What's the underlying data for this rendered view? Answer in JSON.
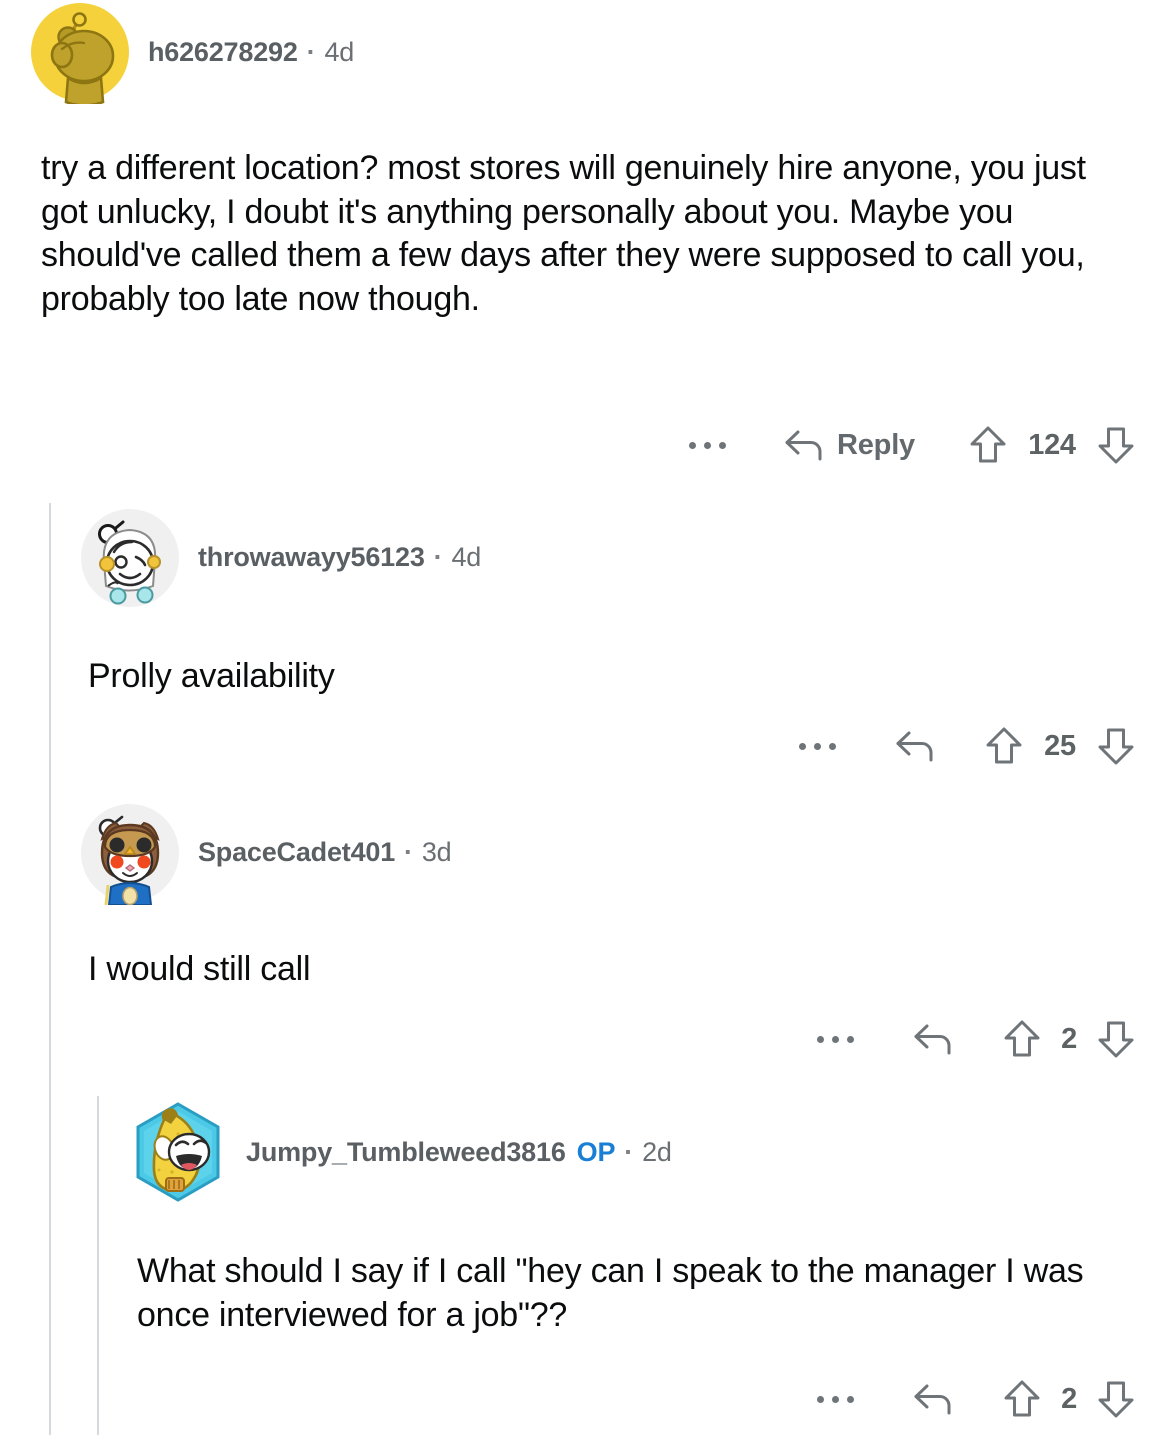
{
  "theme": {
    "background": "#ffffff",
    "text_primary": "#0b0c0d",
    "text_meta": "#5a5f63",
    "icon": "#6f7478",
    "op_blue": "#1a7fd4",
    "thread_line": "#d7dadc"
  },
  "comments": [
    {
      "id": "c1",
      "author": "h626278292",
      "timestamp": "4d",
      "is_op": false,
      "op_label": "",
      "separator": "·",
      "body": "try a different location? most stores will genuinely hire anyone, you just got unlucky, I doubt it's anything personally about you. Maybe you should've called them a few days after they were supposed to call you, probably too late now though.",
      "actions": {
        "more_label": "more-options",
        "reply_label": "Reply",
        "show_reply_label": true,
        "upvote_label": "upvote",
        "downvote_label": "downvote",
        "score": "124"
      },
      "avatar": "snoo-yellow"
    },
    {
      "id": "c2",
      "author": "throwawayy56123",
      "timestamp": "4d",
      "is_op": false,
      "op_label": "",
      "separator": "·",
      "body": "Prolly availability",
      "actions": {
        "more_label": "more-options",
        "reply_label": "",
        "show_reply_label": false,
        "upvote_label": "upvote",
        "downvote_label": "downvote",
        "score": "25"
      },
      "avatar": "snoo-white-longhair"
    },
    {
      "id": "c3",
      "author": "SpaceCadet401",
      "timestamp": "3d",
      "is_op": false,
      "op_label": "",
      "separator": "·",
      "body": "I would still call",
      "actions": {
        "more_label": "more-options",
        "reply_label": "",
        "show_reply_label": false,
        "upvote_label": "upvote",
        "downvote_label": "downvote",
        "score": "2"
      },
      "avatar": "snoo-owl-hood"
    },
    {
      "id": "c4",
      "author": "Jumpy_Tumbleweed3816",
      "timestamp": "2d",
      "is_op": true,
      "op_label": "OP",
      "separator": "·",
      "body": "What should I say if I call \"hey can I speak to the manager I was once interviewed for a job\"??",
      "actions": {
        "more_label": "more-options",
        "reply_label": "",
        "show_reply_label": false,
        "upvote_label": "upvote",
        "downvote_label": "downvote",
        "score": "2"
      },
      "avatar": "banana-hexagon"
    }
  ]
}
